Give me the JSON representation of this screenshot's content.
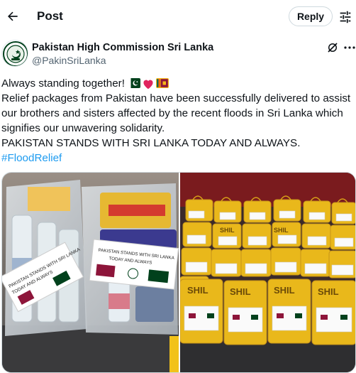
{
  "header": {
    "title": "Post",
    "reply_label": "Reply",
    "back_icon": "arrow-left-icon",
    "filter_icon": "sliders-icon"
  },
  "author": {
    "display_name": "Pakistan High Commission Sri Lanka",
    "handle": "@PakinSriLanka"
  },
  "tweet": {
    "line1": "Always standing together!",
    "line2": "Relief packages from Pakistan have been successfully delivered to assist",
    "line3": "our brothers and sisters affected by the recent floods in Sri Lanka which",
    "line4": "signifies our unwavering solidarity.",
    "line5": "PAKISTAN STANDS WITH SRI LANKA TODAY AND ALWAYS.",
    "hashtag": "#FloodRelief"
  },
  "media": {
    "photo1": {
      "card_text": "PAKISTAN STANDS WITH SRI LANKA TODAY AND ALWAYS"
    },
    "photo2": {
      "bag_brand": "SHILA"
    }
  },
  "colors": {
    "accent": "#1d9bf0",
    "text": "#0f1419",
    "muted": "#536471",
    "pakistan_green": "#01411c",
    "heart_red": "#e0245e",
    "bag_yellow": "#f2c21a"
  }
}
